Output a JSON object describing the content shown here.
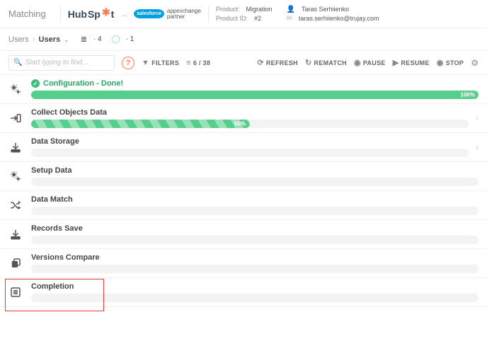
{
  "header": {
    "title": "Matching",
    "source_logo_primary": "Hub",
    "source_logo_secondary": "Sp",
    "target_logo_cloud": "salesforce",
    "target_logo_text_line1": "appexchange",
    "target_logo_text_line2": "partner",
    "product_label": "Product:",
    "product_value": "Migration",
    "product_id_label": "Product ID:",
    "product_id_value": "#2",
    "user_name": "Taras Serhiienko",
    "user_email": "taras.serhiienko@trujay.com"
  },
  "breadcrumb": {
    "root": "Users",
    "current": "Users",
    "list_count": "4",
    "cycle_count": "1"
  },
  "toolbar": {
    "search_placeholder": "Start typing to find...",
    "filters": "FILTERS",
    "range": "6 / 38",
    "refresh": "REFRESH",
    "rematch": "REMATCH",
    "pause": "PAUSE",
    "resume": "RESUME",
    "stop": "STOP"
  },
  "steps": [
    {
      "title": "Configuration - Done!",
      "done": true,
      "progress": 100,
      "pct_label": "100%"
    },
    {
      "title": "Collect Objects Data",
      "progress": 50,
      "pct_label": "50%",
      "striped": true,
      "expandable": true
    },
    {
      "title": "Data Storage",
      "progress": 0,
      "expandable": true
    },
    {
      "title": "Setup Data",
      "progress": 0
    },
    {
      "title": "Data Match",
      "progress": 0
    },
    {
      "title": "Records Save",
      "progress": 0
    },
    {
      "title": "Versions Compare",
      "progress": 0,
      "highlighted": true
    },
    {
      "title": "Completion",
      "progress": 0
    }
  ]
}
